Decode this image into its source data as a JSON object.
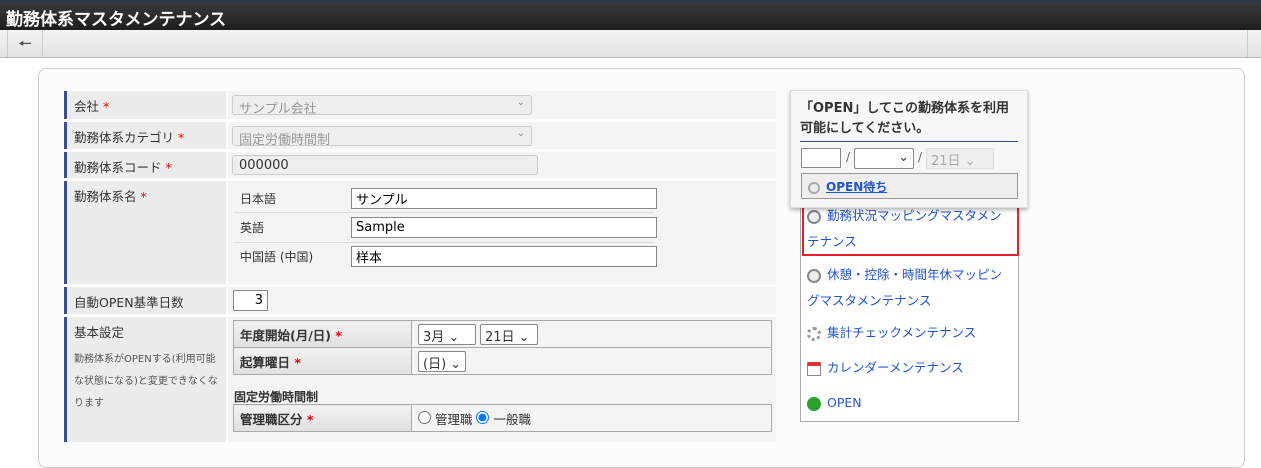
{
  "title": "勤務体系マスタメンテナンス",
  "form": {
    "company_label": "会社",
    "company_value": "サンプル会社",
    "category_label": "勤務体系カテゴリ",
    "category_value": "固定労働時間制",
    "code_label": "勤務体系コード",
    "code_value": "000000",
    "name_label": "勤務体系名",
    "langs": [
      {
        "label": "日本語",
        "value": "サンプル"
      },
      {
        "label": "英語",
        "value": "Sample"
      },
      {
        "label": "中国語 (中国)",
        "value": "样本"
      }
    ],
    "auto_open_label": "自動OPEN基準日数",
    "auto_open_value": "3",
    "basic_label": "基本設定",
    "basic_note": "勤務体系がOPENする(利用可能な状態になる)と変更できなくなります",
    "fiscal_label": "年度開始(月/日)",
    "fiscal_month": "3月",
    "fiscal_day": "21日",
    "weekday_label": "起算曜日",
    "weekday_value": "(日)",
    "section": "固定労働時間制",
    "mgr_label": "管理職区分",
    "opt_mgr": "管理職",
    "opt_general": "一般職",
    "required": "*"
  },
  "popup": {
    "message": "「OPEN」してこの勤務体系を利用可能にしてください。",
    "sep": "/",
    "day": "21日",
    "status": "OPEN待ち"
  },
  "menu": [
    "勤務状況マッピングマスタメンテナンス",
    "休憩・控除・時間年休マッピングマスタメンテナンス",
    "集計チェックメンテナンス",
    "カレンダーメンテナンス",
    "OPEN"
  ],
  "colors": {
    "highlight": "#e8202a",
    "link": "#2255cc"
  }
}
